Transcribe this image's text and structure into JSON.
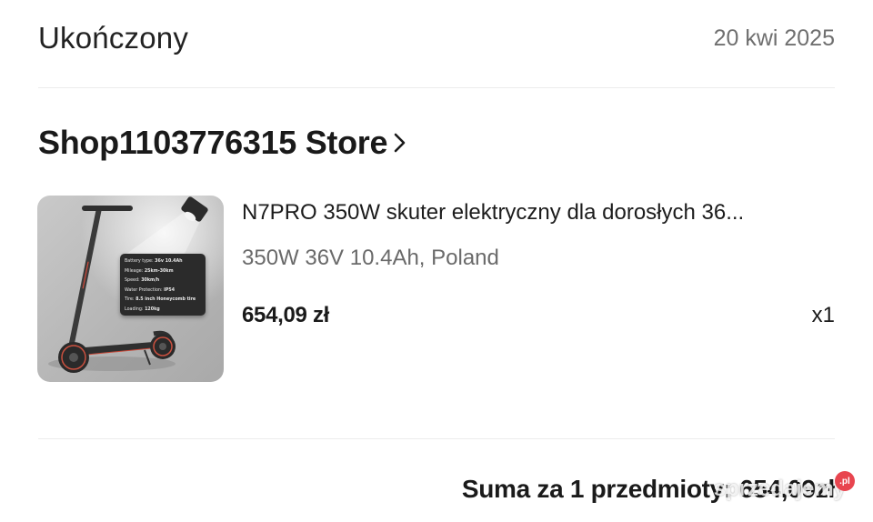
{
  "order": {
    "status": "Ukończony",
    "date": "20 kwi 2025"
  },
  "store": {
    "name": "Shop1103776315 Store"
  },
  "product": {
    "title": "N7PRO 350W skuter elektryczny dla dorosłych 36...",
    "variant": "350W 36V 10.4Ah, Poland",
    "price": "654,09 zł",
    "quantity": "x1",
    "spec_card": {
      "battery_label": "Battery type:",
      "battery_value": "36v 10.4Ah",
      "mileage_label": "Mileage:",
      "mileage_value": "25km-30km",
      "speed_label": "Speed:",
      "speed_value": "30km/h",
      "water_label": "Water Protection:",
      "water_value": "IP54",
      "tire_label": "Tire:",
      "tire_value": "8.5 inch Honeycomb tire",
      "loading_label": "Loading:",
      "loading_value": "120kg"
    }
  },
  "summary": {
    "label": "Suma za 1 przedmioty:",
    "value": "654,09zł"
  },
  "watermark": {
    "text": "sprzedajemy",
    "badge": ".pl"
  }
}
